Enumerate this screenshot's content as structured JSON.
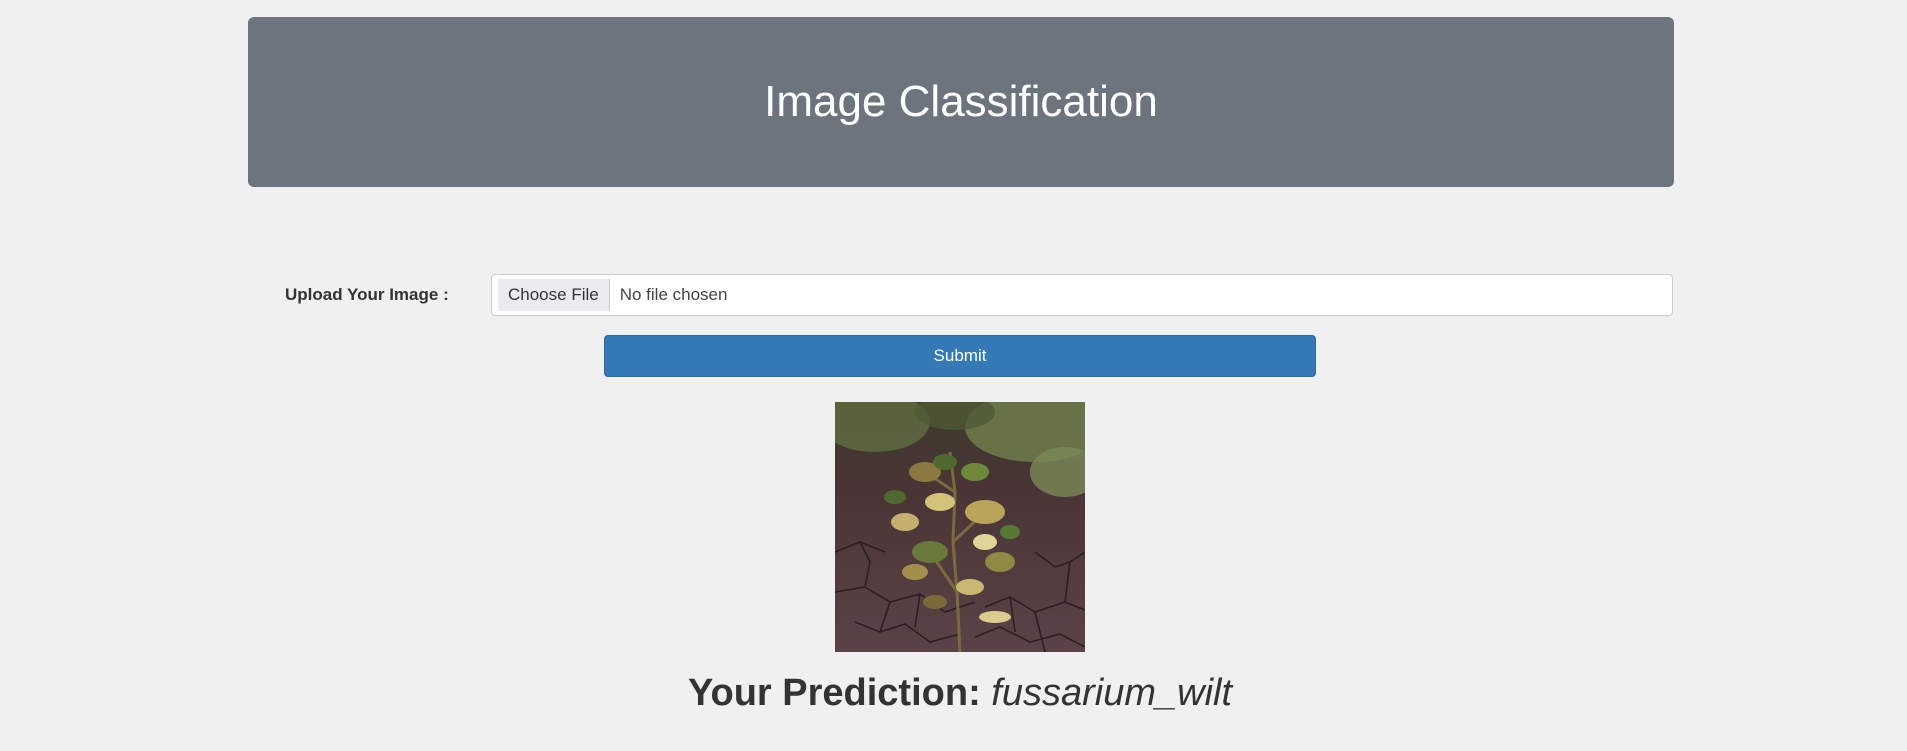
{
  "header": {
    "title": "Image Classification"
  },
  "form": {
    "upload_label": "Upload Your Image :",
    "choose_file_label": "Choose File",
    "file_status": "No file chosen",
    "submit_label": "Submit"
  },
  "result": {
    "prediction_label": "Your Prediction:",
    "prediction_value": "fussarium_wilt"
  },
  "colors": {
    "background": "#f0f0f0",
    "header_bg": "#6c757d",
    "submit_bg": "#337ab7"
  }
}
